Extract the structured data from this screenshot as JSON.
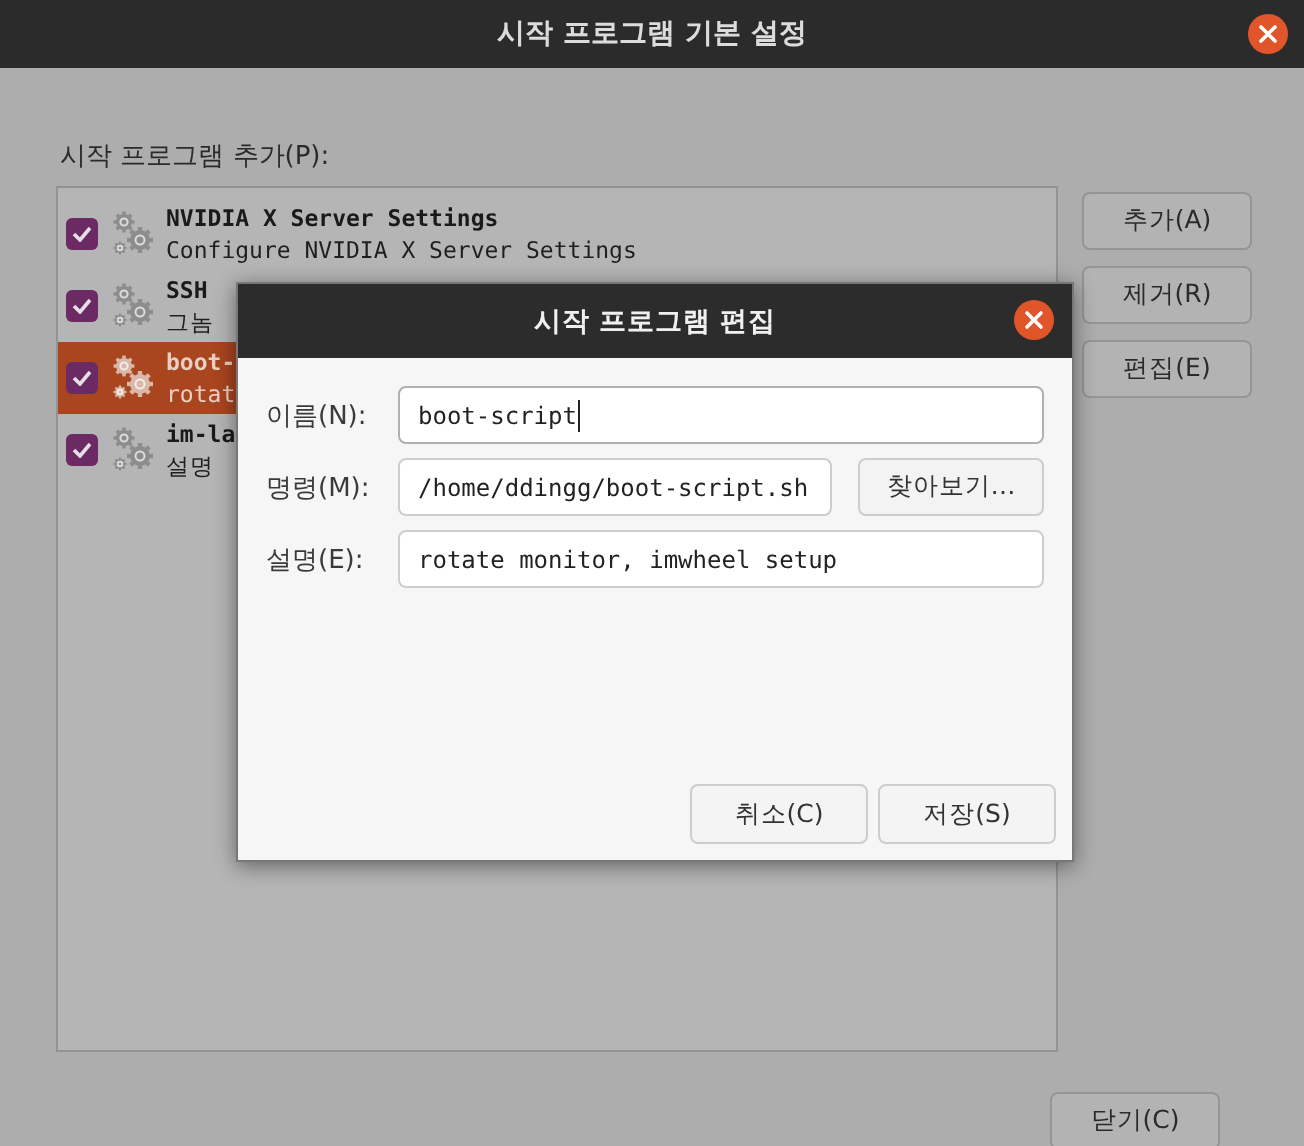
{
  "window": {
    "title": "시작 프로그램 기본 설정"
  },
  "list_label": "시작 프로그램 추가(P):",
  "programs": [
    {
      "name": "NVIDIA X Server Settings",
      "description": "Configure NVIDIA X Server Settings",
      "checked": true,
      "selected": false
    },
    {
      "name": "SSH",
      "description": "그놈",
      "checked": true,
      "selected": false
    },
    {
      "name": "boot-",
      "description": "rotat",
      "checked": true,
      "selected": true
    },
    {
      "name": "im-la",
      "description": "설명",
      "checked": true,
      "selected": false
    }
  ],
  "side_buttons": [
    "추가(A)",
    "제거(R)",
    "편집(E)"
  ],
  "close_button": "닫기(C)",
  "dialog": {
    "title": "시작 프로그램 편집",
    "fields": [
      {
        "label": "이름(N):",
        "value": "boot-script",
        "focused": true
      },
      {
        "label": "명령(M):",
        "value": "/home/ddingg/boot-script.sh",
        "focused": false,
        "button": "찾아보기…"
      },
      {
        "label": "설명(E):",
        "value": "rotate monitor, imwheel setup",
        "focused": false
      }
    ],
    "buttons": [
      "취소(C)",
      "저장(S)"
    ]
  }
}
